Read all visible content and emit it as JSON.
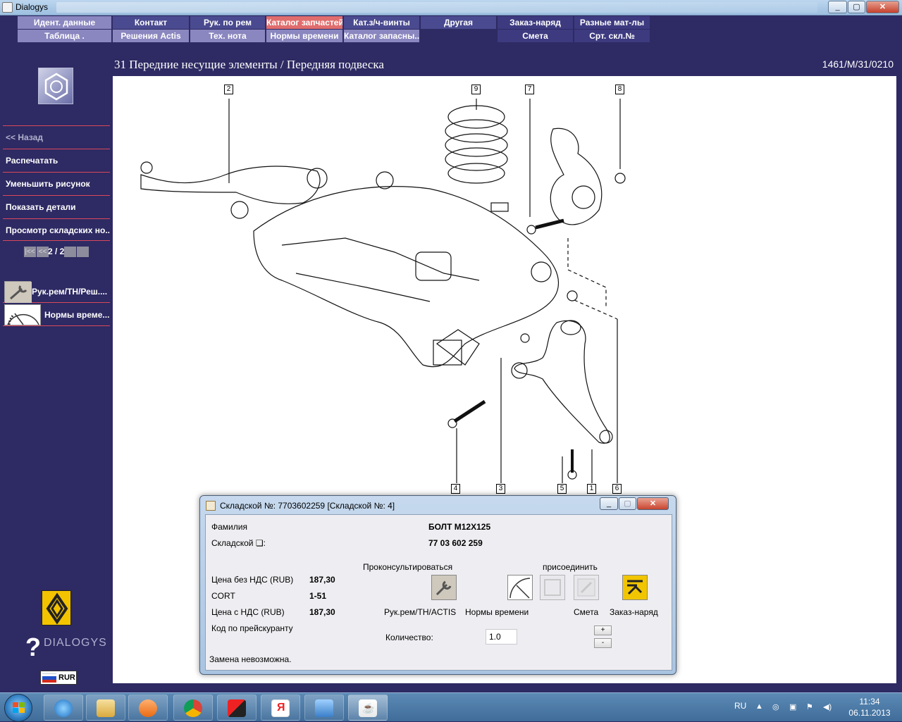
{
  "window": {
    "title": "Dialogys",
    "controls": [
      "_",
      "▢",
      "✕"
    ]
  },
  "menu": {
    "row1": [
      "Идент. данные",
      "Контакт",
      "Рук. по рем",
      "Каталог запчастей",
      "Кат.з/ч-винты",
      "Другая",
      "Заказ-наряд",
      "Разные мат-лы"
    ],
    "row2": [
      "Таблица .",
      "Решения Actis",
      "Тех. нота",
      "Нормы времени",
      "Каталог запасны...",
      "Смета",
      "Срт. скл.№"
    ],
    "active": "Каталог запчастей"
  },
  "header": {
    "page_title": "31 Передние несущие элементы / Передняя подвеска",
    "ref_code": "1461/M/31/0210"
  },
  "sidebar": {
    "back": "<< Назад",
    "items": [
      "Распечатать",
      "Уменьшить рисунок",
      "Показать детали",
      "Просмотр складских но..."
    ],
    "pager": {
      "first": "|<<",
      "prev": "<<",
      "current": "2 / 2",
      "next": ">>",
      "last": ">>|"
    },
    "tools": [
      {
        "label": "Рук.рем/TH/Реш....",
        "icon": "wrench-icon"
      },
      {
        "label": "Нормы време...",
        "icon": "gauge-icon"
      }
    ],
    "brand": "DIALOGYS",
    "brand_mark": "?",
    "currency": "RUR"
  },
  "diagram": {
    "callouts": [
      "2",
      "9",
      "7",
      "8",
      "4",
      "3",
      "5",
      "1",
      "6"
    ]
  },
  "dialog": {
    "title": "Складской №: 7703602259 [Складской №: 4]",
    "fields": {
      "family_label": "Фамилия",
      "family_value": "БОЛТ М12Х125",
      "partno_label": "Складской ❏:",
      "partno_value": "77 03 602 259",
      "price_net_label": "Цена без НДС (RUB)",
      "price_net_value": "187,30",
      "cort_label": "CORT",
      "cort_value": "1-51",
      "price_vat_label": "Цена с НДС (RUB)",
      "price_vat_value": "187,30",
      "pricelist_label": "Код по прейскуранту"
    },
    "consult_label": "Проконсультироваться",
    "attach_label": "присоединить",
    "buttons": {
      "manual": "Рук.рем/TH/ACTIS",
      "times": "Нормы времени",
      "estimate": "Смета",
      "order": "Заказ-наряд"
    },
    "quantity_label": "Количество:",
    "quantity_value": "1.0",
    "plus": "+",
    "minus": "-",
    "note": "Замена невозможна."
  },
  "taskbar": {
    "apps": [
      "ie-icon",
      "explorer-icon",
      "media-icon",
      "chrome-icon",
      "kaspersky-icon",
      "yandex-icon",
      "audio-icon",
      "java-icon"
    ],
    "lang": "RU",
    "time": "11:34",
    "date": "06.11.2013"
  },
  "colors": {
    "background": "#2e2a63",
    "menu": "#4a4a90",
    "menu_light": "#8a86bf",
    "active_menu": "#e06d6d",
    "divider": "#d9485b",
    "renault_yellow": "#f3c300"
  }
}
